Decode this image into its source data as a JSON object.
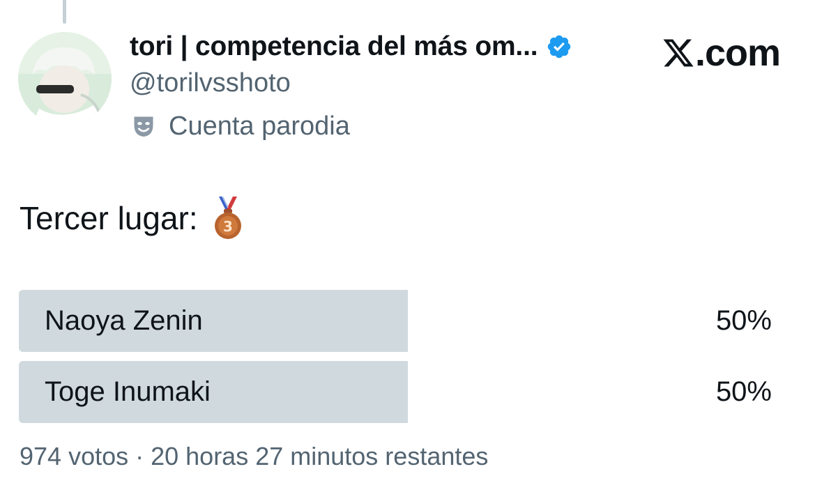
{
  "author": {
    "display_name": "tori | competencia del más om...",
    "handle": "@torilvsshoto",
    "verified_icon": "verified-badge-icon",
    "label_icon": "parody-mask-icon",
    "label": "Cuenta parodia"
  },
  "brand": {
    "icon": "x-logo-icon",
    "text": ".com"
  },
  "tweet": {
    "text": "Tercer lugar:",
    "emoji_icon": "bronze-medal-icon"
  },
  "poll": {
    "options": [
      {
        "label": "Naoya Zenin",
        "percent_text": "50%",
        "share": 0.5
      },
      {
        "label": "Toge Inumaki",
        "percent_text": "50%",
        "share": 0.5
      }
    ],
    "footer": "974 votos · 20 horas 27 minutos restantes"
  },
  "colors": {
    "verified": "#1d9bf0",
    "muted_text": "#536471",
    "poll_fill": "#cfd9de",
    "text": "#0f1419"
  }
}
